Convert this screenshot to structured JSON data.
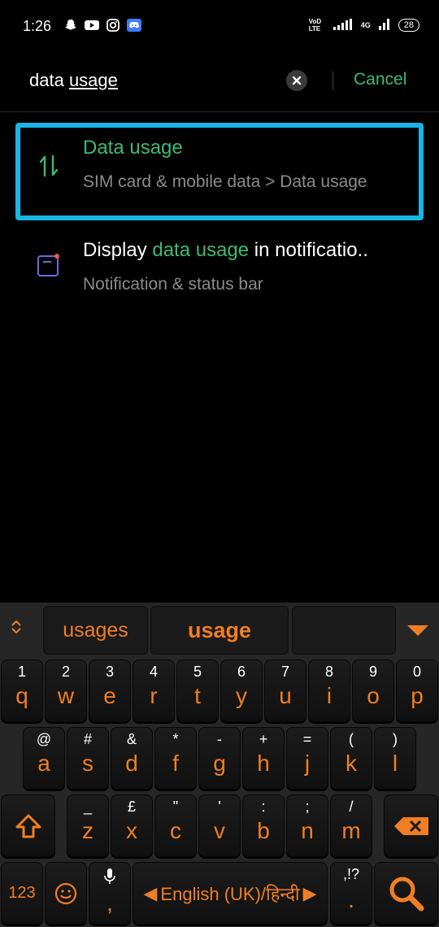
{
  "status_bar": {
    "time": "1:26",
    "left_icons": [
      "snapchat-icon",
      "youtube-icon",
      "instagram-icon",
      "discord-icon"
    ],
    "network_label": "VoD LTE",
    "network2_label": "4G",
    "battery": "28"
  },
  "search": {
    "query_plain": "data ",
    "query_underlined": "usage",
    "cancel_label": "Cancel"
  },
  "results": [
    {
      "icon": "data-transfer-icon",
      "title": "Data usage",
      "subtitle": "SIM card & mobile data > Data usage",
      "highlighted": true
    },
    {
      "icon": "notification-bar-icon",
      "title_before": "Display ",
      "title_match": "data usage",
      "title_after": " in notificatio..",
      "subtitle": "Notification & status bar"
    }
  ],
  "keyboard": {
    "suggestions": [
      "usages",
      "usage",
      ""
    ],
    "row1": [
      {
        "sec": "1",
        "pri": "q"
      },
      {
        "sec": "2",
        "pri": "w"
      },
      {
        "sec": "3",
        "pri": "e"
      },
      {
        "sec": "4",
        "pri": "r"
      },
      {
        "sec": "5",
        "pri": "t"
      },
      {
        "sec": "6",
        "pri": "y"
      },
      {
        "sec": "7",
        "pri": "u"
      },
      {
        "sec": "8",
        "pri": "i"
      },
      {
        "sec": "9",
        "pri": "o"
      },
      {
        "sec": "0",
        "pri": "p"
      }
    ],
    "row2": [
      {
        "sec": "@",
        "pri": "a"
      },
      {
        "sec": "#",
        "pri": "s"
      },
      {
        "sec": "&",
        "pri": "d"
      },
      {
        "sec": "*",
        "pri": "f"
      },
      {
        "sec": "-",
        "pri": "g"
      },
      {
        "sec": "+",
        "pri": "h"
      },
      {
        "sec": "=",
        "pri": "j"
      },
      {
        "sec": "(",
        "pri": "k"
      },
      {
        "sec": ")",
        "pri": "l"
      }
    ],
    "row3": [
      {
        "sec": "_",
        "pri": "z"
      },
      {
        "sec": "£",
        "pri": "x"
      },
      {
        "sec": "\"",
        "pri": "c"
      },
      {
        "sec": "'",
        "pri": "v"
      },
      {
        "sec": ":",
        "pri": "b"
      },
      {
        "sec": ";",
        "pri": "n"
      },
      {
        "sec": "/",
        "pri": "m"
      }
    ],
    "numbers_label": "123",
    "comma_label": ",",
    "space_label": "English (UK)/हिन्दी",
    "period_sec": ",!?",
    "period_label": ".",
    "accent_color": "#f07e25"
  },
  "colors": {
    "highlight_border": "#19b5e6",
    "green": "#3cba74"
  }
}
